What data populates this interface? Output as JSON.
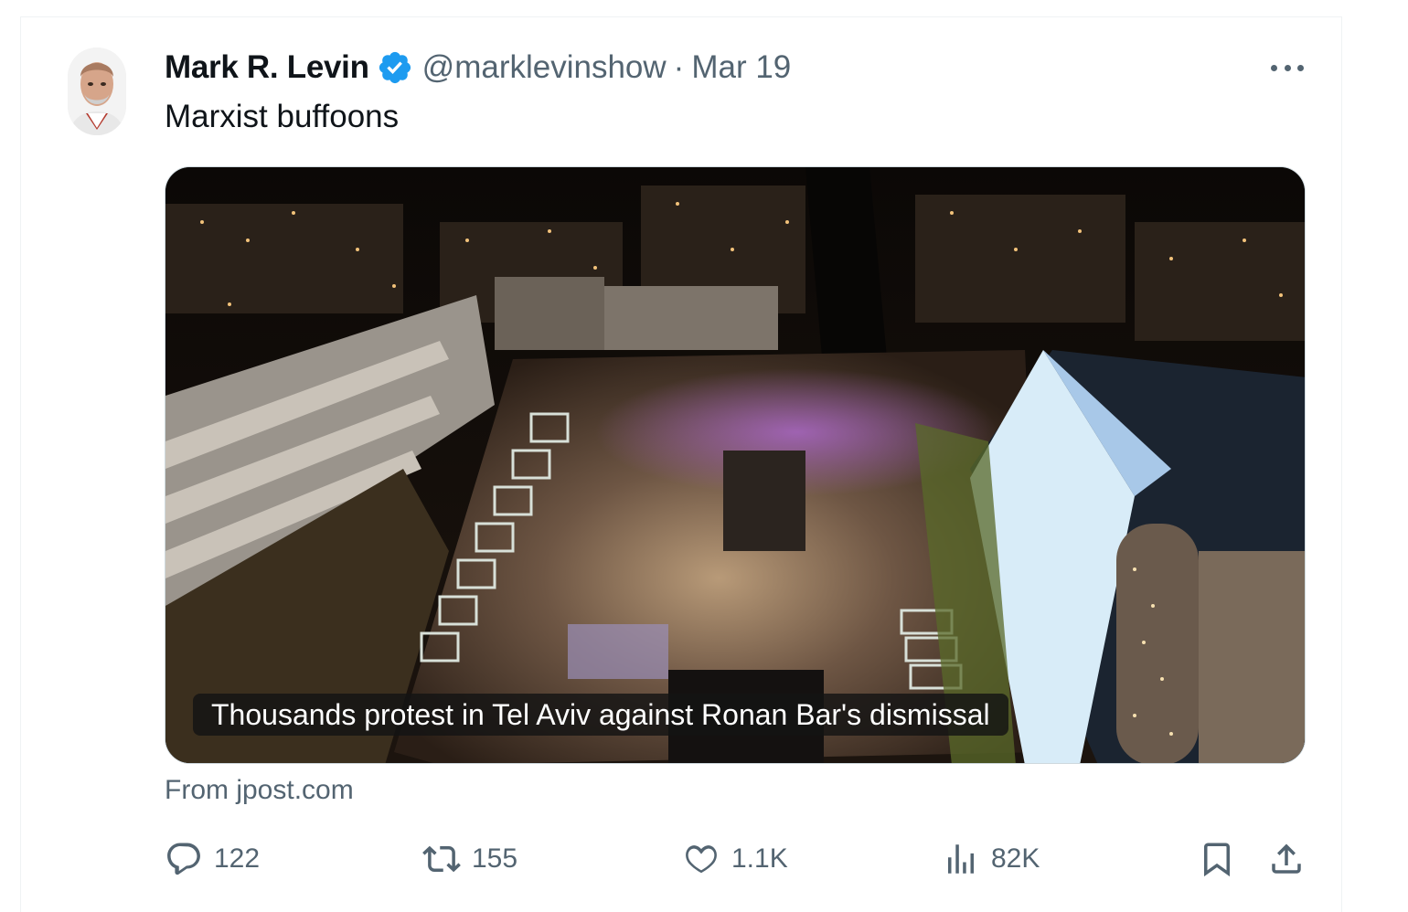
{
  "tweet": {
    "author_name": "Mark R. Levin",
    "handle": "@marklevinshow",
    "separator": "·",
    "date": "Mar 19",
    "text": "Marxist buffoons",
    "media_caption": "Thousands protest in Tel Aviv against Ronan Bar's dismissal",
    "source": "From jpost.com"
  },
  "actions": {
    "replies": "122",
    "reposts": "155",
    "likes": "1.1K",
    "views": "82K"
  },
  "colors": {
    "verified": "#1d9bf0",
    "secondary_text": "#536471",
    "primary_text": "#0f1419"
  },
  "icons": [
    "verified-badge-icon",
    "more-icon",
    "reply-icon",
    "repost-icon",
    "like-icon",
    "views-icon",
    "bookmark-icon",
    "share-icon"
  ]
}
